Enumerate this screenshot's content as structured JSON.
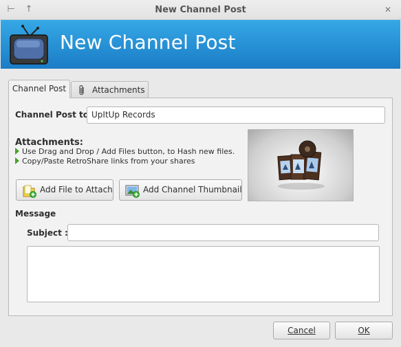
{
  "window": {
    "title": "New Channel Post",
    "pin_glyph": "⊢",
    "up_glyph": "↑",
    "close_glyph": "✕"
  },
  "banner": {
    "title": "New Channel Post",
    "icon": "tv-icon"
  },
  "tabs": [
    {
      "label": "Channel Post",
      "active": true
    },
    {
      "label": "Attachments",
      "active": false,
      "icon": "paperclip-icon"
    }
  ],
  "channel_post": {
    "label": "Channel Post to:",
    "value": "UpItUp Records"
  },
  "attachments": {
    "title": "Attachments:",
    "hints": [
      "Use Drag and Drop / Add Files button, to Hash new files.",
      "Copy/Paste RetroShare links from your shares"
    ],
    "add_file_label": "Add File to Attach",
    "add_thumbnail_label": "Add Channel Thumbnail"
  },
  "message": {
    "heading": "Message",
    "subject_label": "Subject :",
    "subject_value": "",
    "body_value": ""
  },
  "footer": {
    "cancel_label": "Cancel",
    "ok_label": "OK"
  },
  "colors": {
    "banner_top": "#35a8e6",
    "banner_bottom": "#1b7cc6",
    "hint_arrow": "#4aa02c"
  }
}
